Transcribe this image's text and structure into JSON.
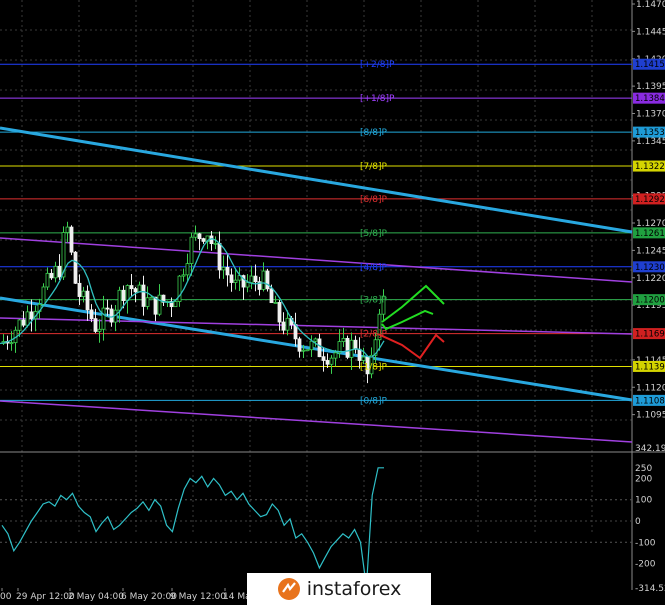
{
  "price_axis": {
    "ticks": [
      "1.1470",
      "1.1445",
      "1.1420",
      "1.1395",
      "1.1370",
      "1.1345",
      "1.1295",
      "1.1270",
      "1.1245",
      "1.1220",
      "1.1195",
      "1.1145",
      "1.1120",
      "1.1095"
    ],
    "boxes": [
      {
        "text": "1.1415",
        "color": "#1f3fd0"
      },
      {
        "text": "1.1384",
        "color": "#8a2be2"
      },
      {
        "text": "1.1353",
        "color": "#1e9bd7"
      },
      {
        "text": "1.1322",
        "color": "#d4d400"
      },
      {
        "text": "1.1292",
        "color": "#d02020"
      },
      {
        "text": "1.1261",
        "color": "#20a040"
      },
      {
        "text": "1.1230",
        "color": "#1f3fd0"
      },
      {
        "text": "1.1200",
        "color": "#20a040"
      },
      {
        "text": "1.1169",
        "color": "#d02020"
      },
      {
        "text": "1.1139",
        "color": "#d4d400"
      },
      {
        "text": "1.1108",
        "color": "#1e9bd7"
      }
    ]
  },
  "murrey_levels": [
    {
      "price": 1.1415,
      "label": "[+2/8]P",
      "color": "#2040ff"
    },
    {
      "price": 1.1384,
      "label": "[+1/8]P",
      "color": "#a040ff"
    },
    {
      "price": 1.1353,
      "label": "[8/8]P",
      "color": "#22aadd"
    },
    {
      "price": 1.1322,
      "label": "[7/8]P",
      "color": "#e0e000"
    },
    {
      "price": 1.1292,
      "label": "[6/8]P",
      "color": "#e03030"
    },
    {
      "price": 1.1261,
      "label": "[5/8]P",
      "color": "#30b050"
    },
    {
      "price": 1.123,
      "label": "[4/8]P",
      "color": "#2040ff"
    },
    {
      "price": 1.12,
      "label": "[3/8]P",
      "color": "#30b050"
    },
    {
      "price": 1.1169,
      "label": "[2/8]P",
      "color": "#e03030"
    },
    {
      "price": 1.1139,
      "label": "[1/8]P",
      "color": "#e0e000"
    },
    {
      "price": 1.1108,
      "label": "[0/8]P",
      "color": "#22aadd"
    }
  ],
  "time_axis": {
    "labels": [
      "00",
      "29 Apr 12:00",
      "2 May 04:00",
      "6 May 20:00",
      "9 May 12:00",
      "14 Ma",
      "0"
    ]
  },
  "oscillator": {
    "ticks": [
      "342.1937",
      "250",
      "200",
      "100",
      "0",
      "-100",
      "-200",
      "-314.522"
    ],
    "values": [
      -20,
      -60,
      -140,
      -100,
      -50,
      0,
      40,
      80,
      90,
      70,
      120,
      100,
      130,
      70,
      40,
      20,
      -50,
      -10,
      20,
      -40,
      -20,
      10,
      40,
      60,
      90,
      50,
      100,
      70,
      -20,
      -50,
      60,
      150,
      200,
      180,
      210,
      160,
      200,
      170,
      120,
      140,
      100,
      130,
      80,
      50,
      20,
      30,
      80,
      50,
      -20,
      10,
      -80,
      -60,
      -100,
      -150,
      -220,
      -170,
      -120,
      -90,
      -60,
      -80,
      -40,
      -100,
      -310,
      120,
      250,
      250
    ]
  },
  "branding": {
    "logo_text": "instaforex"
  }
}
